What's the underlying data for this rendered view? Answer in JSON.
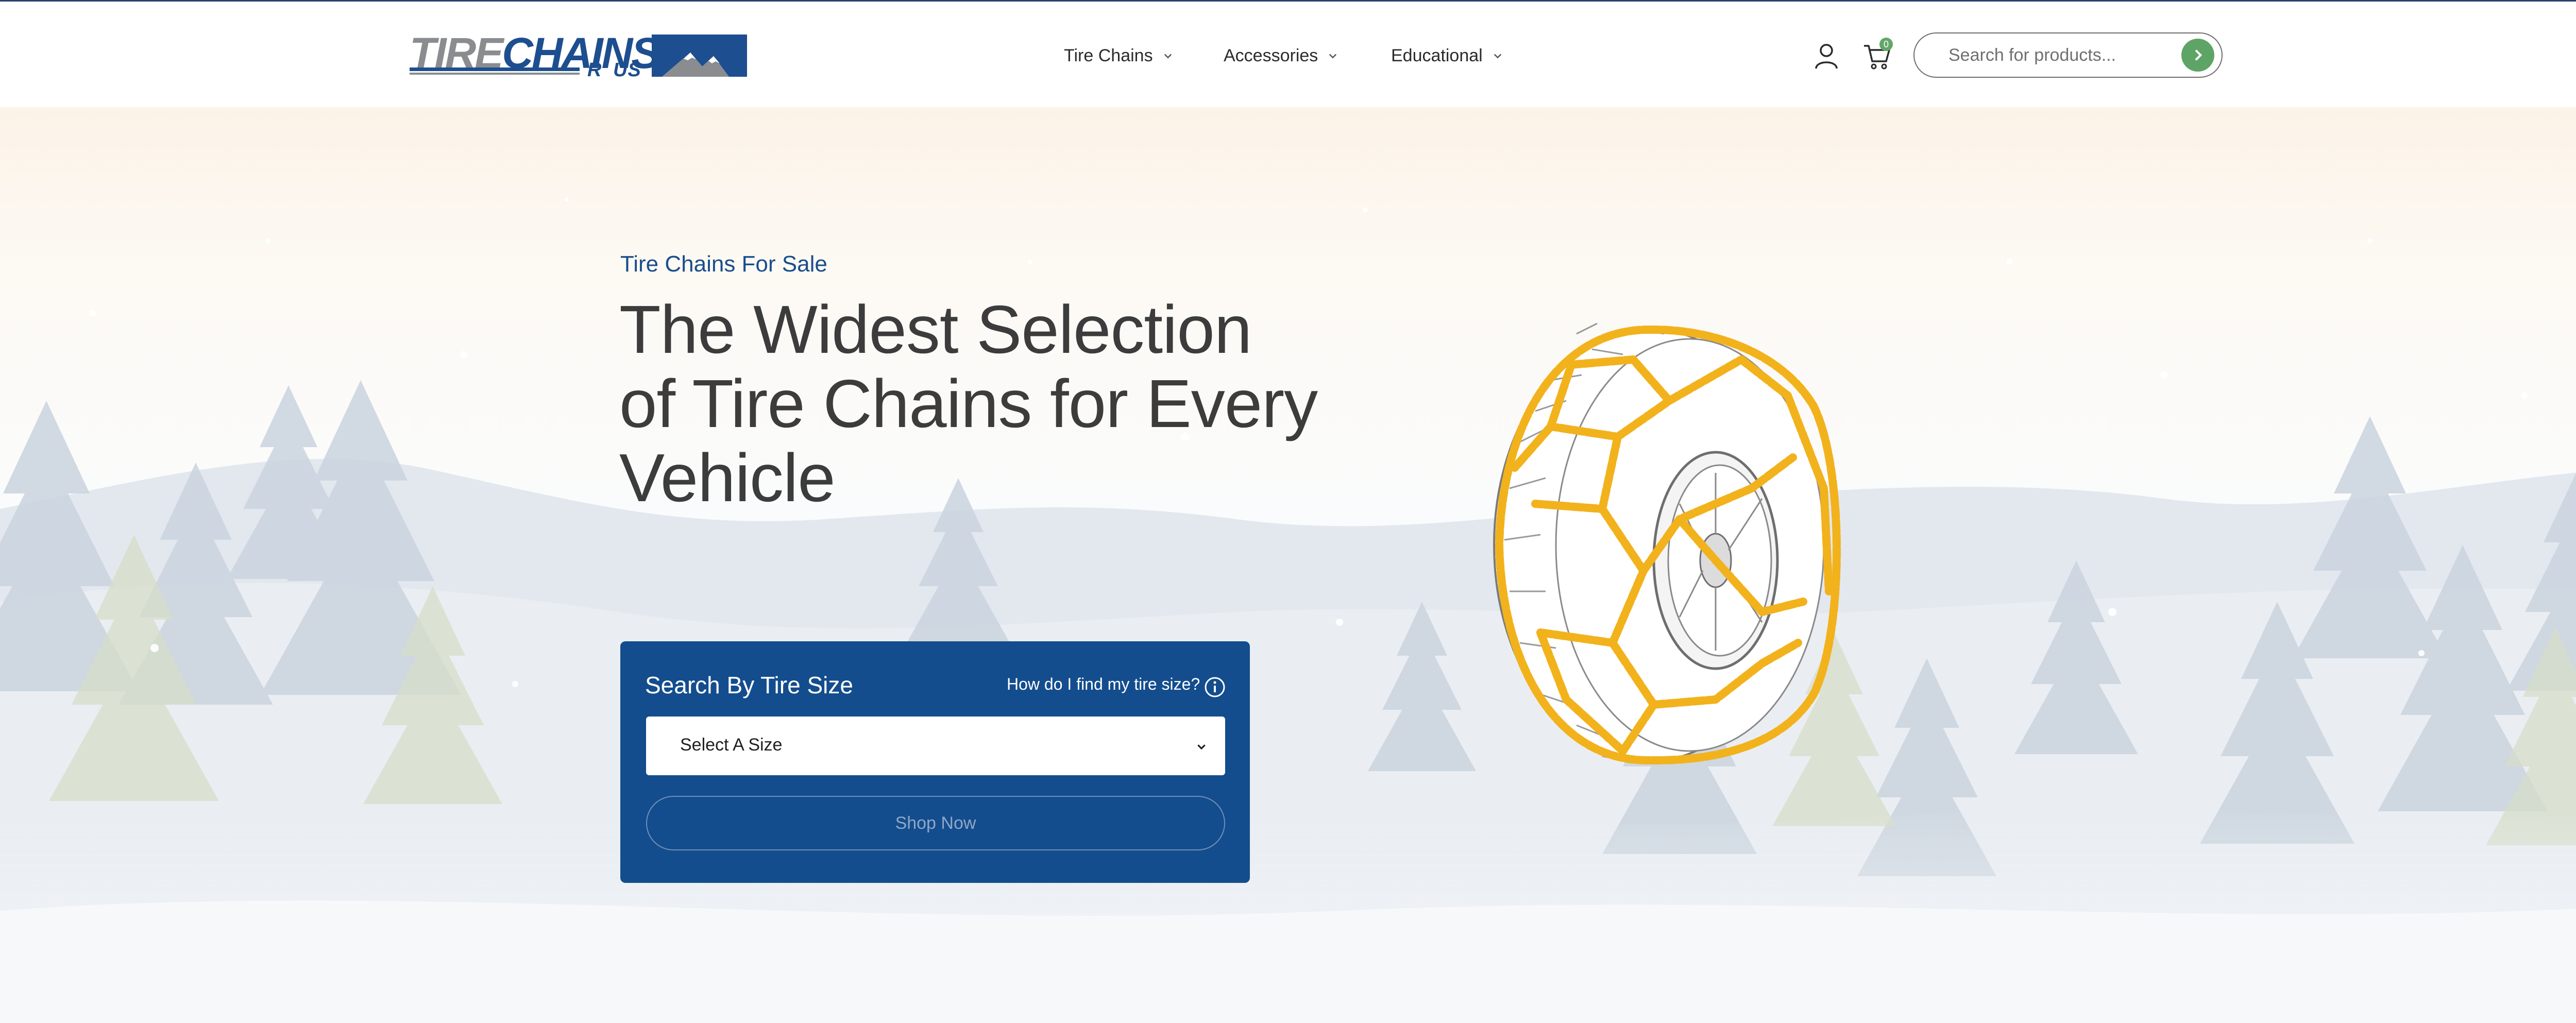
{
  "header": {
    "logo": {
      "text_main_gray": "TIRE",
      "text_main_blue": "CHAINS",
      "text_sub": "'R' US"
    },
    "nav": [
      {
        "label": "Tire Chains"
      },
      {
        "label": "Accessories"
      },
      {
        "label": "Educational"
      }
    ],
    "cart": {
      "count": "0"
    },
    "search": {
      "placeholder": "Search for products...",
      "value": ""
    },
    "icons": {
      "account": "user-icon",
      "cart": "cart-icon",
      "search_submit": "chevron-right-icon",
      "nav_dropdown": "chevron-down-icon"
    }
  },
  "hero": {
    "eyebrow": "Tire Chains For Sale",
    "headline": "The Widest Selection of Tire Chains for Every Vehicle",
    "search_panel": {
      "title": "Search By Tire Size",
      "help_link": "How do I find my tire size?",
      "select_label": "Select A Size",
      "button_label": "Shop Now"
    }
  },
  "colors": {
    "brand_blue": "#134d8d",
    "accent_green": "#5ea466",
    "chain_yellow": "#f2b21c",
    "text_dark": "#3c3c3c"
  }
}
